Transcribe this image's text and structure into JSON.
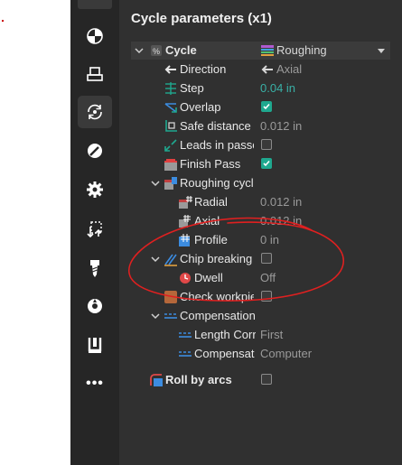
{
  "panel": {
    "title": "Cycle parameters (x1)"
  },
  "toolbar": {
    "items": [
      {
        "icon": "pie-chart-icon"
      },
      {
        "icon": "stack-icon"
      },
      {
        "icon": "cycle-arrows-icon"
      },
      {
        "icon": "strategy-compass-icon"
      },
      {
        "icon": "gear-icon"
      },
      {
        "icon": "transfer-arrows-icon"
      },
      {
        "icon": "drill-icon"
      },
      {
        "icon": "disc-icon"
      },
      {
        "icon": "clamp-icon"
      },
      {
        "icon": "more-icon"
      }
    ],
    "more_label": "•••"
  },
  "rows": {
    "cycle": {
      "label": "Cycle",
      "value": "Roughing"
    },
    "direction": {
      "label": "Direction",
      "value": "Axial"
    },
    "step": {
      "label": "Step",
      "value": "0.04 in"
    },
    "overlap": {
      "label": "Overlap",
      "checked": true
    },
    "safe_distance": {
      "label": "Safe distance",
      "value": "0.012 in"
    },
    "leads_in_passes": {
      "label": "Leads in passe",
      "checked": false
    },
    "finish_pass": {
      "label": "Finish Pass",
      "checked": true
    },
    "roughing_cycle": {
      "label": "Roughing cycl"
    },
    "radial": {
      "label": "Radial",
      "value": "0.012 in"
    },
    "axial": {
      "label": "Axial",
      "value": "0.012 in"
    },
    "profile": {
      "label": "Profile",
      "value": "0 in"
    },
    "chip_breaking": {
      "label": "Chip breaking",
      "checked": false
    },
    "dwell": {
      "label": "Dwell",
      "value": "Off"
    },
    "check_workpiece": {
      "label": "Check workpie",
      "checked": false
    },
    "compensation": {
      "label": "Compensation"
    },
    "length_correction": {
      "label": "Length Corr",
      "value": "First"
    },
    "compensation_mode": {
      "label": "Compensat",
      "value": "Computer"
    },
    "roll_by_arcs": {
      "label": "Roll by arcs",
      "checked": false
    }
  },
  "colors": {
    "panel_bg": "#303030",
    "toolbar_bg": "#262626",
    "accent_teal": "#1fa88f",
    "annotation_red": "#e02020"
  }
}
